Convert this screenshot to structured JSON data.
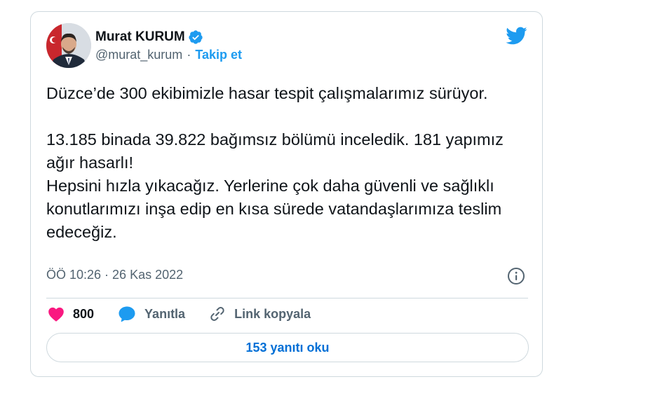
{
  "tweet": {
    "author": {
      "name": "Murat KURUM",
      "handle": "@murat_kurum",
      "separator": "·",
      "follow_label": "Takip et",
      "verified": true
    },
    "text": "Düzce’de 300 ekibimizle hasar tespit çalışmalarımız sürüyor.\n\n13.185 binada 39.822 bağımsız bölümü inceledik. 181 yapımız ağır hasarlı!\nHepsini hızla yıkacağız. Yerlerine çok daha güvenli ve sağlıklı konutlarımızı inşa edip en kısa sürede vatandaşlarımıza teslim edeceğiz.",
    "timestamp": "ÖÖ 10:26 · 26 Kas 2022",
    "actions": {
      "like_count": "800",
      "reply_label": "Yanıtla",
      "copy_link_label": "Link kopyala"
    },
    "read_replies_label": "153 yanıtı oku"
  },
  "colors": {
    "accent": "#1d9bf0",
    "like": "#f91880",
    "secondary_text": "#536471",
    "border": "#cfd9de"
  },
  "icons": [
    "verified-badge-icon",
    "twitter-bird-icon",
    "info-icon",
    "heart-icon",
    "reply-bubble-icon",
    "link-icon"
  ]
}
